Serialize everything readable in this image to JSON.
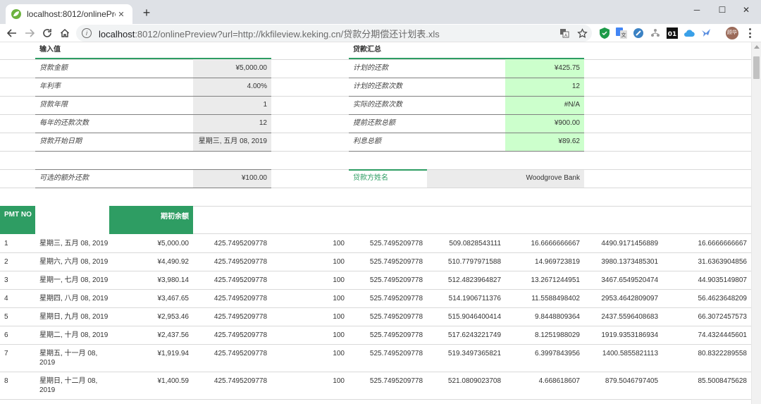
{
  "browser": {
    "tab_title": "localhost:8012/onlinePreview?",
    "tab_close": "✕",
    "new_tab": "+",
    "window": {
      "minimize": "─",
      "maximize": "☐",
      "close": "✕"
    },
    "url_host": "localhost",
    "url_rest": ":8012/onlinePreview?url=http://kkfileview.keking.cn/贷款分期偿还计划表.xls",
    "profile_initials": "顾华",
    "colors": {
      "tabbar": "#dee1e6",
      "accent_green": "#2e9d63",
      "highlight_green": "#ccffcc"
    },
    "icons": [
      "back-icon",
      "forward-icon",
      "reload-icon",
      "home-icon",
      "info-icon",
      "translate-icon",
      "bookmark-star-icon"
    ],
    "extensions": [
      "adguard-icon",
      "google-translate-icon",
      "speed-icon",
      "tree-icon",
      "01-icon",
      "cloud-icon",
      "bird-icon"
    ]
  },
  "sheet": {
    "input_header": "输入值",
    "summary_header": "贷款汇总",
    "inputs": [
      {
        "label": "贷款金额",
        "value": "¥5,000.00"
      },
      {
        "label": "年利率",
        "value": "4.00%"
      },
      {
        "label": "贷款年限",
        "value": "1"
      },
      {
        "label": "每年的还款次数",
        "value": "12"
      },
      {
        "label": "贷款开始日期",
        "value": "星期三, 五月 08, 2019"
      }
    ],
    "summary": [
      {
        "label": "计划的还款",
        "value": "¥425.75"
      },
      {
        "label": "计划的还款次数",
        "value": "12"
      },
      {
        "label": "实际的还款次数",
        "value": "#N/A"
      },
      {
        "label": "提前还款总额",
        "value": "¥900.00"
      },
      {
        "label": "利息总额",
        "value": "¥89.62"
      }
    ],
    "extra_label": "可选的额外还款",
    "extra_value": "¥100.00",
    "lender_label": "贷款方姓名",
    "lender_value": "Woodgrove Bank",
    "table": {
      "col_pmt": "PMT NO",
      "col_balance": "期初余额",
      "rows": [
        {
          "no": "1",
          "date": "星期三, 五月 08, 2019",
          "balance": "¥5,000.00",
          "payment": "425.7495209778",
          "extra": "100",
          "total": "525.7495209778",
          "principal": "509.0828543111",
          "interest": "16.6666666667",
          "ending": "4490.9171456889",
          "cumulative": "16.6666666667"
        },
        {
          "no": "2",
          "date": "星期六, 六月 08, 2019",
          "balance": "¥4,490.92",
          "payment": "425.7495209778",
          "extra": "100",
          "total": "525.7495209778",
          "principal": "510.7797971588",
          "interest": "14.969723819",
          "ending": "3980.1373485301",
          "cumulative": "31.6363904856"
        },
        {
          "no": "3",
          "date": "星期一, 七月 08, 2019",
          "balance": "¥3,980.14",
          "payment": "425.7495209778",
          "extra": "100",
          "total": "525.7495209778",
          "principal": "512.4823964827",
          "interest": "13.2671244951",
          "ending": "3467.6549520474",
          "cumulative": "44.9035149807"
        },
        {
          "no": "4",
          "date": "星期四, 八月 08, 2019",
          "balance": "¥3,467.65",
          "payment": "425.7495209778",
          "extra": "100",
          "total": "525.7495209778",
          "principal": "514.1906711376",
          "interest": "11.5588498402",
          "ending": "2953.4642809097",
          "cumulative": "56.4623648209"
        },
        {
          "no": "5",
          "date": "星期日, 九月 08, 2019",
          "balance": "¥2,953.46",
          "payment": "425.7495209778",
          "extra": "100",
          "total": "525.7495209778",
          "principal": "515.9046400414",
          "interest": "9.8448809364",
          "ending": "2437.5596408683",
          "cumulative": "66.3072457573"
        },
        {
          "no": "6",
          "date": "星期二, 十月 08, 2019",
          "balance": "¥2,437.56",
          "payment": "425.7495209778",
          "extra": "100",
          "total": "525.7495209778",
          "principal": "517.6243221749",
          "interest": "8.1251988029",
          "ending": "1919.9353186934",
          "cumulative": "74.4324445601"
        },
        {
          "no": "7",
          "date": "星期五, 十一月 08, 2019",
          "balance": "¥1,919.94",
          "payment": "425.7495209778",
          "extra": "100",
          "total": "525.7495209778",
          "principal": "519.3497365821",
          "interest": "6.3997843956",
          "ending": "1400.5855821113",
          "cumulative": "80.8322289558"
        },
        {
          "no": "8",
          "date": "星期日, 十二月 08, 2019",
          "balance": "¥1,400.59",
          "payment": "425.7495209778",
          "extra": "100",
          "total": "525.7495209778",
          "principal": "521.0809023708",
          "interest": "4.668618607",
          "ending": "879.5046797405",
          "cumulative": "85.5008475628"
        }
      ]
    }
  }
}
